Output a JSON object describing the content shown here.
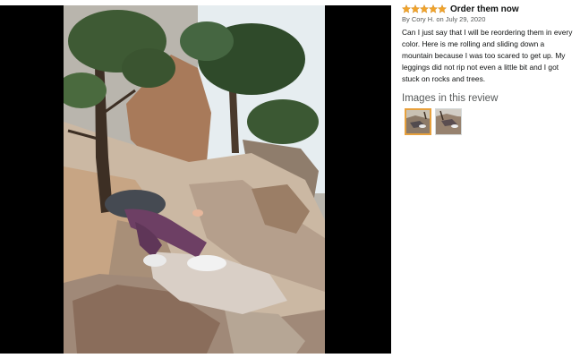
{
  "review": {
    "rating": 5,
    "rating_max": 5,
    "title": "Order them now",
    "meta": "By Cory H. on July 29, 2020",
    "body": "Can I just say that I will be reordering them in every color. Here is me rolling and sliding down a mountain because I was too scared to get up. My leggings did not rip not even a little bit and I got stuck on rocks and trees."
  },
  "images_section": {
    "heading": "Images in this review",
    "thumbnail_count": 2,
    "selected_index": 0
  },
  "colors": {
    "star": "#f0a32b",
    "selected_border": "#e7a13d",
    "media_background": "#000000",
    "text_primary": "#0f1111",
    "text_secondary": "#565959"
  },
  "icons": {
    "star": "star-icon"
  }
}
